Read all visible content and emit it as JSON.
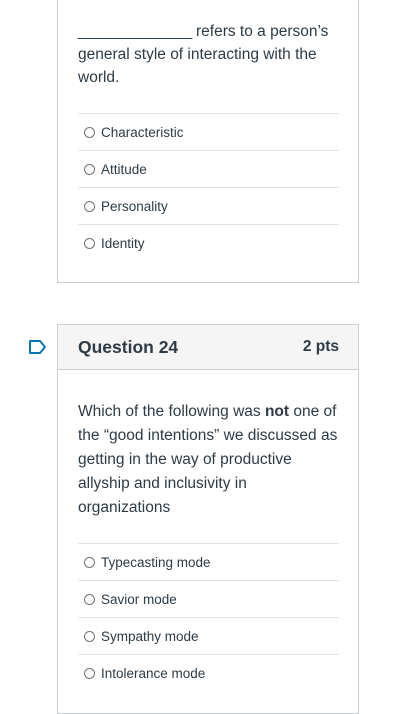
{
  "question23": {
    "blank": "______________",
    "text": " refers to a person’s general style of interacting with the world.",
    "answers": [
      "Characteristic",
      "Attitude",
      "Personality",
      "Identity"
    ]
  },
  "question24": {
    "title": "Question 24",
    "points": "2 pts",
    "text_before": "Which of the following was ",
    "text_bold": "not",
    "text_after": " one of the “good intentions” we discussed as getting in the way of productive allyship and inclusivity in organizations",
    "answers": [
      "Typecasting mode",
      "Savior mode",
      "Sympathy mode",
      "Intolerance mode"
    ]
  },
  "colors": {
    "flag": "#0374b5",
    "border": "#c7cdd1",
    "header_bg": "#f5f5f5",
    "text": "#2d3b45"
  }
}
